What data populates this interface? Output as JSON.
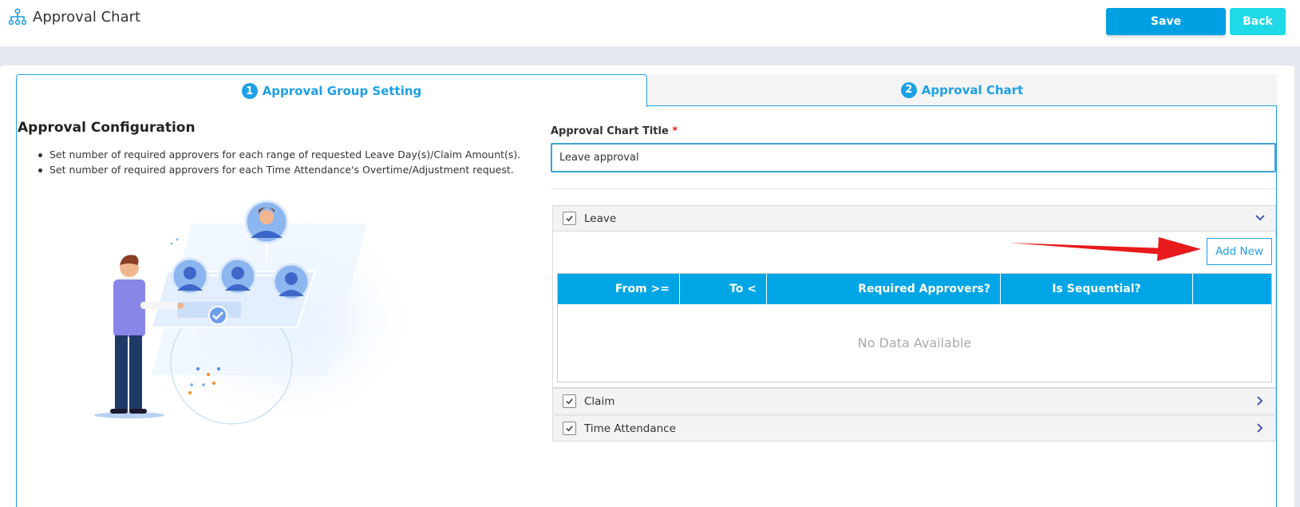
{
  "header": {
    "title": "Approval Chart",
    "save_label": "Save",
    "back_label": "Back"
  },
  "tabs": [
    {
      "number": "1",
      "label": "Approval Group Setting",
      "active": true
    },
    {
      "number": "2",
      "label": "Approval Chart",
      "active": false
    }
  ],
  "config": {
    "title": "Approval Configuration",
    "bullets": [
      "Set number of required approvers for each range of requested Leave Day(s)/Claim Amount(s).",
      "Set number of required approvers for each Time Attendance's Overtime/Adjustment request."
    ]
  },
  "form": {
    "title_label": "Approval Chart Title",
    "required_mark": "*",
    "title_value": "Leave approval"
  },
  "sections": {
    "leave": {
      "label": "Leave",
      "checked": true,
      "expanded": true
    },
    "claim": {
      "label": "Claim",
      "checked": true,
      "expanded": false
    },
    "time_attendance": {
      "label": "Time Attendance",
      "checked": true,
      "expanded": false
    }
  },
  "leave_table": {
    "add_new_label": "Add New",
    "columns": [
      "From >=",
      "To <",
      "Required Approvers?",
      "Is Sequential?",
      ""
    ],
    "empty_text": "No Data Available"
  },
  "colors": {
    "accent": "#00a0e3",
    "back_button": "#1fd8e8",
    "table_header": "#00a5e6",
    "annotation_arrow": "#e8191b"
  }
}
